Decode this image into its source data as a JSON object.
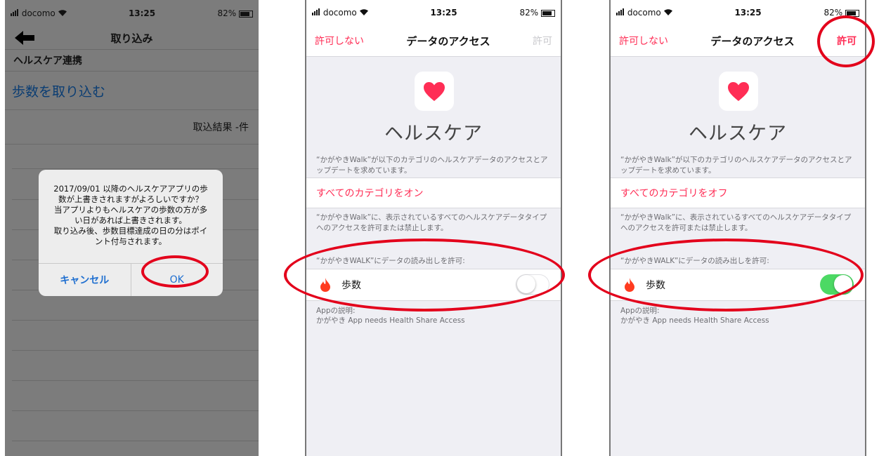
{
  "status": {
    "carrier": "docomo",
    "time": "13:25",
    "battery": "82%"
  },
  "panel1": {
    "nav_title": "取り込み",
    "section_header": "ヘルスケア連携",
    "import_link": "歩数を取り込む",
    "result_text": "取込結果 -件",
    "alert": {
      "message": "2017/09/01 以降のヘルスケアアプリの歩\n数が上書きされますがよろしいですか？\n当アプリよりもヘルスケアの歩数の方が多\nい日があれば上書きされます。\n取り込み後、歩数目標達成の日の分はポイ\nント付与されます。",
      "cancel": "キャンセル",
      "ok": "OK"
    }
  },
  "panel2": {
    "nav_left": "許可しない",
    "nav_title": "データのアクセス",
    "nav_right": "許可",
    "app_name": "ヘルスケア",
    "desc1": "“かがやきWalk”が以下のカテゴリのヘルスケアデータのアクセスとアップデートを求めています。",
    "all_toggle": "すべてのカテゴリをオン",
    "desc2": "“かがやきWalk”に、表示されているすべてのヘルスケアデータタイプへのアクセスを許可または禁止します。",
    "read_label": "“かがやきWALK”にデータの読み出しを許可:",
    "step_label": "歩数",
    "step_enabled": false,
    "app_desc_title": "Appの説明:",
    "app_desc": "かがやき App needs Health Share Access"
  },
  "panel3": {
    "nav_left": "許可しない",
    "nav_title": "データのアクセス",
    "nav_right": "許可",
    "app_name": "ヘルスケア",
    "desc1": "“かがやきWalk”が以下のカテゴリのヘルスケアデータのアクセスとアップデートを求めています。",
    "all_toggle": "すべてのカテゴリをオフ",
    "desc2": "“かがやきWalk”に、表示されているすべてのヘルスケアデータタイプへのアクセスを許可または禁止します。",
    "read_label": "“かがやきWALK”にデータの読み出しを許可:",
    "step_label": "歩数",
    "step_enabled": true,
    "app_desc_title": "Appの説明:",
    "app_desc": "かがやき App needs Health Share Access"
  },
  "colors": {
    "health_pink": "#ff2d55",
    "toggle_on": "#4cd964",
    "ios_blue": "#1f6fd0",
    "annotation_red": "#e3001b"
  },
  "icons": [
    "signal-icon",
    "wifi-icon",
    "battery-icon",
    "back-arrow-icon",
    "heart-icon",
    "flame-icon"
  ]
}
